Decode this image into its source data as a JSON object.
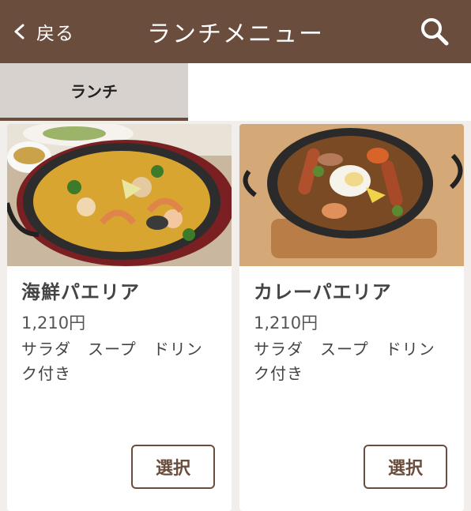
{
  "header": {
    "back_label": "戻る",
    "title": "ランチメニュー",
    "back_icon": "chevron-left-icon",
    "search_icon": "search-icon"
  },
  "tabs": [
    {
      "label": "ランチ",
      "active": true
    }
  ],
  "colors": {
    "header_bg": "#6b4d3d",
    "accent": "#6b4d3d",
    "tab_active_bg": "#d8d2cf",
    "page_bg": "#f1eeec"
  },
  "menu_items": [
    {
      "name": "海鮮パエリア",
      "price": "1,210円",
      "description": "サラダ　スープ　ドリンク付き",
      "select_label": "選択"
    },
    {
      "name": "カレーパエリア",
      "price": "1,210円",
      "description": "サラダ　スープ　ドリンク付き",
      "select_label": "選択"
    }
  ]
}
